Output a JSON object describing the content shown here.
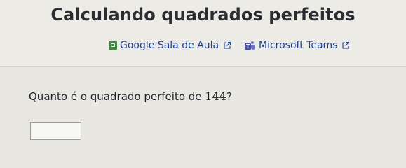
{
  "header": {
    "title": "Calculando quadrados perfeitos"
  },
  "share": {
    "classroom": {
      "label": "Google Sala de Aula",
      "icon": "google-classroom-icon",
      "external_icon": "external-link-icon",
      "color": "#1b3f8f"
    },
    "teams": {
      "label": "Microsoft Teams",
      "icon": "microsoft-teams-icon",
      "external_icon": "external-link-icon",
      "color": "#1b3f8f"
    }
  },
  "question": {
    "prefix": "Quanto é o quadrado perfeito de ",
    "number": "144",
    "suffix": "?"
  },
  "answer": {
    "value": "",
    "placeholder": ""
  },
  "colors": {
    "background": "#e8e7e2",
    "link": "#1b3f8f",
    "classroom_green": "#3a8b3f",
    "teams_purple": "#4b53a8"
  }
}
